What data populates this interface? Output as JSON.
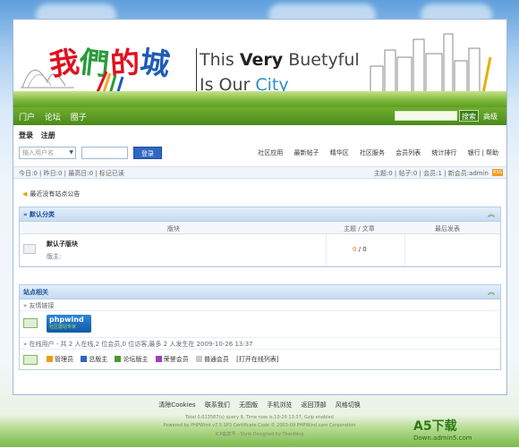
{
  "banner": {
    "logo_cn": [
      "我",
      "們",
      "的",
      "城"
    ],
    "tagline_1_prefix": "This ",
    "tagline_1_bold": "Very",
    "tagline_1_suffix": " Buetyful",
    "tagline_2_prefix": "Is Our ",
    "tagline_2_city": "City"
  },
  "topnav": {
    "items": [
      "门户",
      "论坛",
      "圈子"
    ],
    "search_button": "搜索",
    "advanced": "高级"
  },
  "login": {
    "links": [
      "登录",
      "注册"
    ],
    "username_placeholder": "输入用户名",
    "submit": "登录"
  },
  "mainnav": {
    "items": [
      "社区应用",
      "最新帖子",
      "精华区",
      "社区服务",
      "会员列表",
      "统计排行",
      "银行",
      "帮助"
    ]
  },
  "stats": {
    "left": "今日:0 | 昨日:0 | 最高日:0 | 标记已读",
    "right": "主题:0 | 帖子:0 | 会员:1 | 新会员:admin",
    "rss": "RSS"
  },
  "notice": "最近没有站点公告",
  "default_section": {
    "title": "» 默认分类",
    "columns": [
      "版块",
      "主题 / 文章",
      "最后发表"
    ],
    "forums": [
      {
        "name": "默认子版块",
        "moderator": "版主:",
        "count_hl": "0",
        "count_rest": " / 0"
      }
    ]
  },
  "site_section": {
    "title": "站点相关",
    "friend_links_label": "» 友情链接",
    "partner_logo_main": "phpwind",
    "partner_logo_sub": "社区建站专家",
    "online_label": "» 在线用户  - 共 2 人在线,2 位会员,0 位访客,最多 2 人发生在 2009-10-26 13:37",
    "legend": [
      "管理员",
      "总版主",
      "论坛版主",
      "荣誉会员",
      "普通会员"
    ],
    "legend_colors": [
      "#e8a000",
      "#2f67c3",
      "#4a9a2a",
      "#9a3fb8",
      "#c8c8c8"
    ],
    "legend_action": "[打开在线列表]"
  },
  "footer": {
    "links": [
      "清除Cookies",
      "联系我们",
      "无图版",
      "手机浏览",
      "返回顶部",
      "风格切换"
    ],
    "line1": "Total 0.013587(s) query 9, Time now is:10-26 13:37, Gzip enabled",
    "line2": "Powered by PHPWind v7.5 SP3 Certificate Code © 2003-09 PHPWind.com Corporation",
    "line3": "ICP备案号 - Style Designed by ThanNing"
  },
  "watermark": {
    "big": "A5下载",
    "small": "Down.admin5.com"
  }
}
